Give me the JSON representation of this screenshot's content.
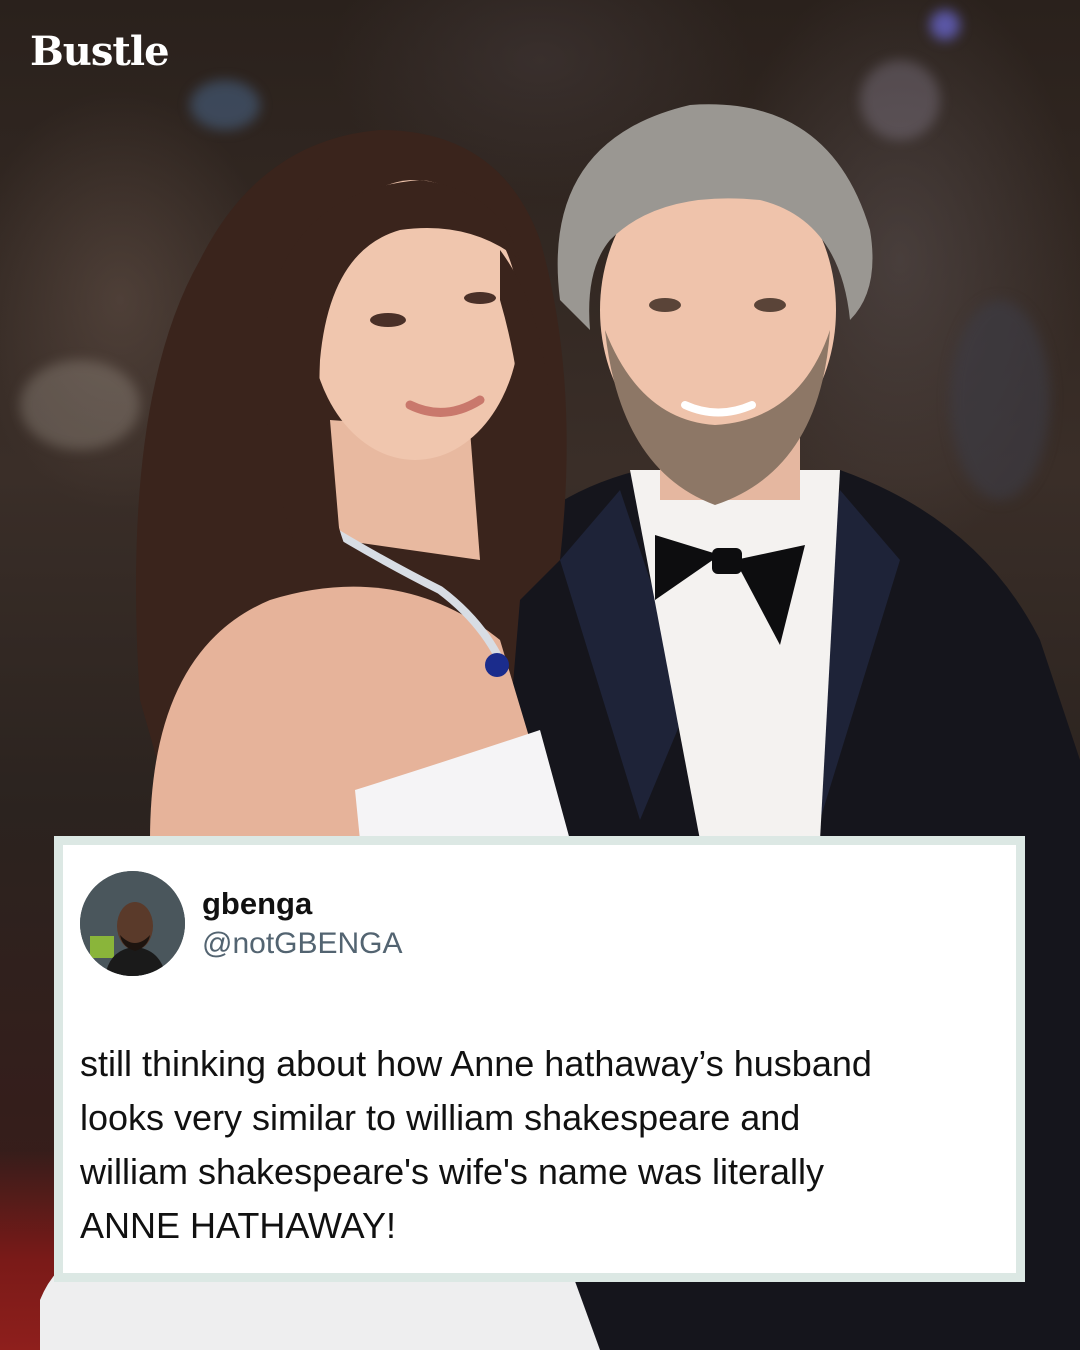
{
  "brand": {
    "logo_text": "Bustle"
  },
  "photo": {
    "subject_icon": "red-carpet-photo",
    "background_color": "#2a211c",
    "carpet_color": "#8e1f1c"
  },
  "tweet": {
    "display_name": "gbenga",
    "handle": "@notGBENGA",
    "avatar_icon": "user-avatar-photo",
    "text_lines": [
      "still thinking about how Anne hathaway’s husband",
      "looks very similar to william shakespeare and",
      "william shakespeare's wife's name was literally",
      "ANNE HATHAWAY!"
    ],
    "card_border_color": "#dce8e4",
    "handle_color": "#536471"
  }
}
